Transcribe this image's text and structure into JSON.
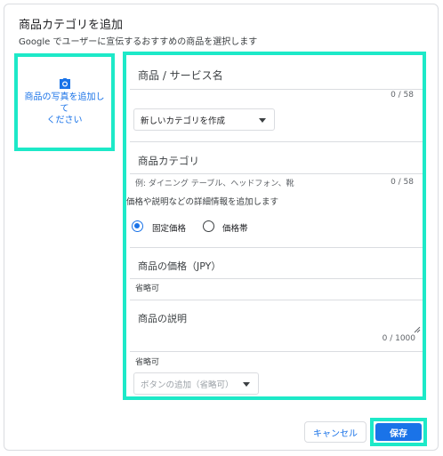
{
  "dialog": {
    "title": "商品カテゴリを追加",
    "subtitle": "Google でユーザーに宣伝するおすすめの商品を選択します"
  },
  "photo": {
    "icon": "camera-icon",
    "label_line1": "商品の写真を追加して",
    "label_line2": "ください"
  },
  "form": {
    "name": {
      "label": "商品 / サービス名",
      "counter": "0 / 58"
    },
    "category_select": {
      "value": "新しいカテゴリを作成"
    },
    "category": {
      "label": "商品カテゴリ",
      "hint": "例: ダイニング テーブル、ヘッドフォン、靴",
      "counter": "0 / 58"
    },
    "details_note": "価格や説明などの詳細情報を追加します",
    "price_type": {
      "options": [
        {
          "label": "固定価格",
          "selected": true
        },
        {
          "label": "価格帯",
          "selected": false
        }
      ]
    },
    "price": {
      "label": "商品の価格（JPY）",
      "optional": "省略可"
    },
    "description": {
      "label": "商品の説明",
      "counter": "0 / 1000",
      "optional": "省略可"
    },
    "button_select": {
      "placeholder": "ボタンの追加（省略可）"
    }
  },
  "footer": {
    "cancel_label": "キャンセル",
    "save_label": "保存"
  },
  "colors": {
    "accent": "#1a73e8",
    "highlight": "#1de9c8"
  }
}
